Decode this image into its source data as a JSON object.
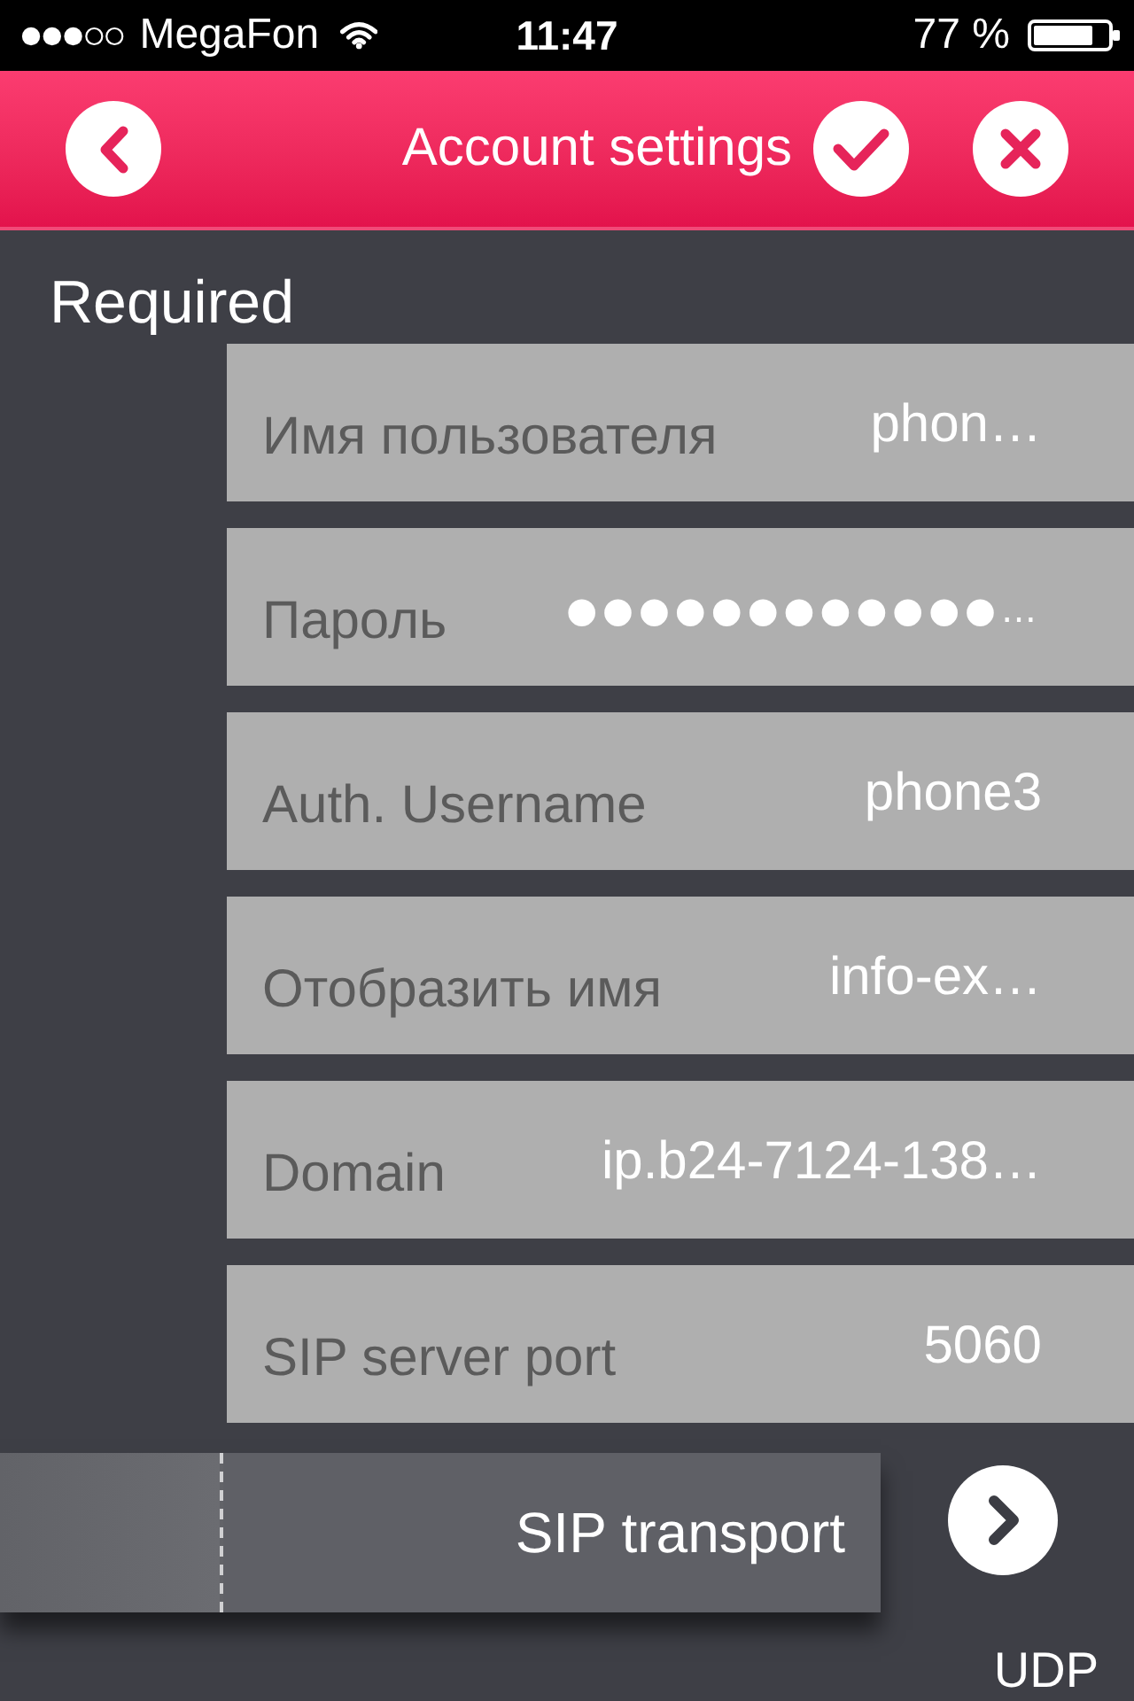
{
  "status_bar": {
    "carrier": "MegaFon",
    "time": "11:47",
    "battery": "77 %"
  },
  "header": {
    "title": "Account settings"
  },
  "section": {
    "title": "Required",
    "fields": [
      {
        "kind": "text",
        "label": "Имя пользователя",
        "value": "phon…"
      },
      {
        "kind": "password",
        "label": "Пароль",
        "value": "●●●●●●●●●●●●…"
      },
      {
        "kind": "text",
        "label": "Auth. Username",
        "value": "phone3"
      },
      {
        "kind": "text",
        "label": "Отобразить имя",
        "value": "info-ex…"
      },
      {
        "kind": "text",
        "label": "Domain",
        "value": "ip.b24-7124-138…"
      },
      {
        "kind": "text",
        "label": "SIP server port",
        "value": "5060"
      }
    ]
  },
  "transport": {
    "label": "SIP transport",
    "value": "UDP"
  }
}
